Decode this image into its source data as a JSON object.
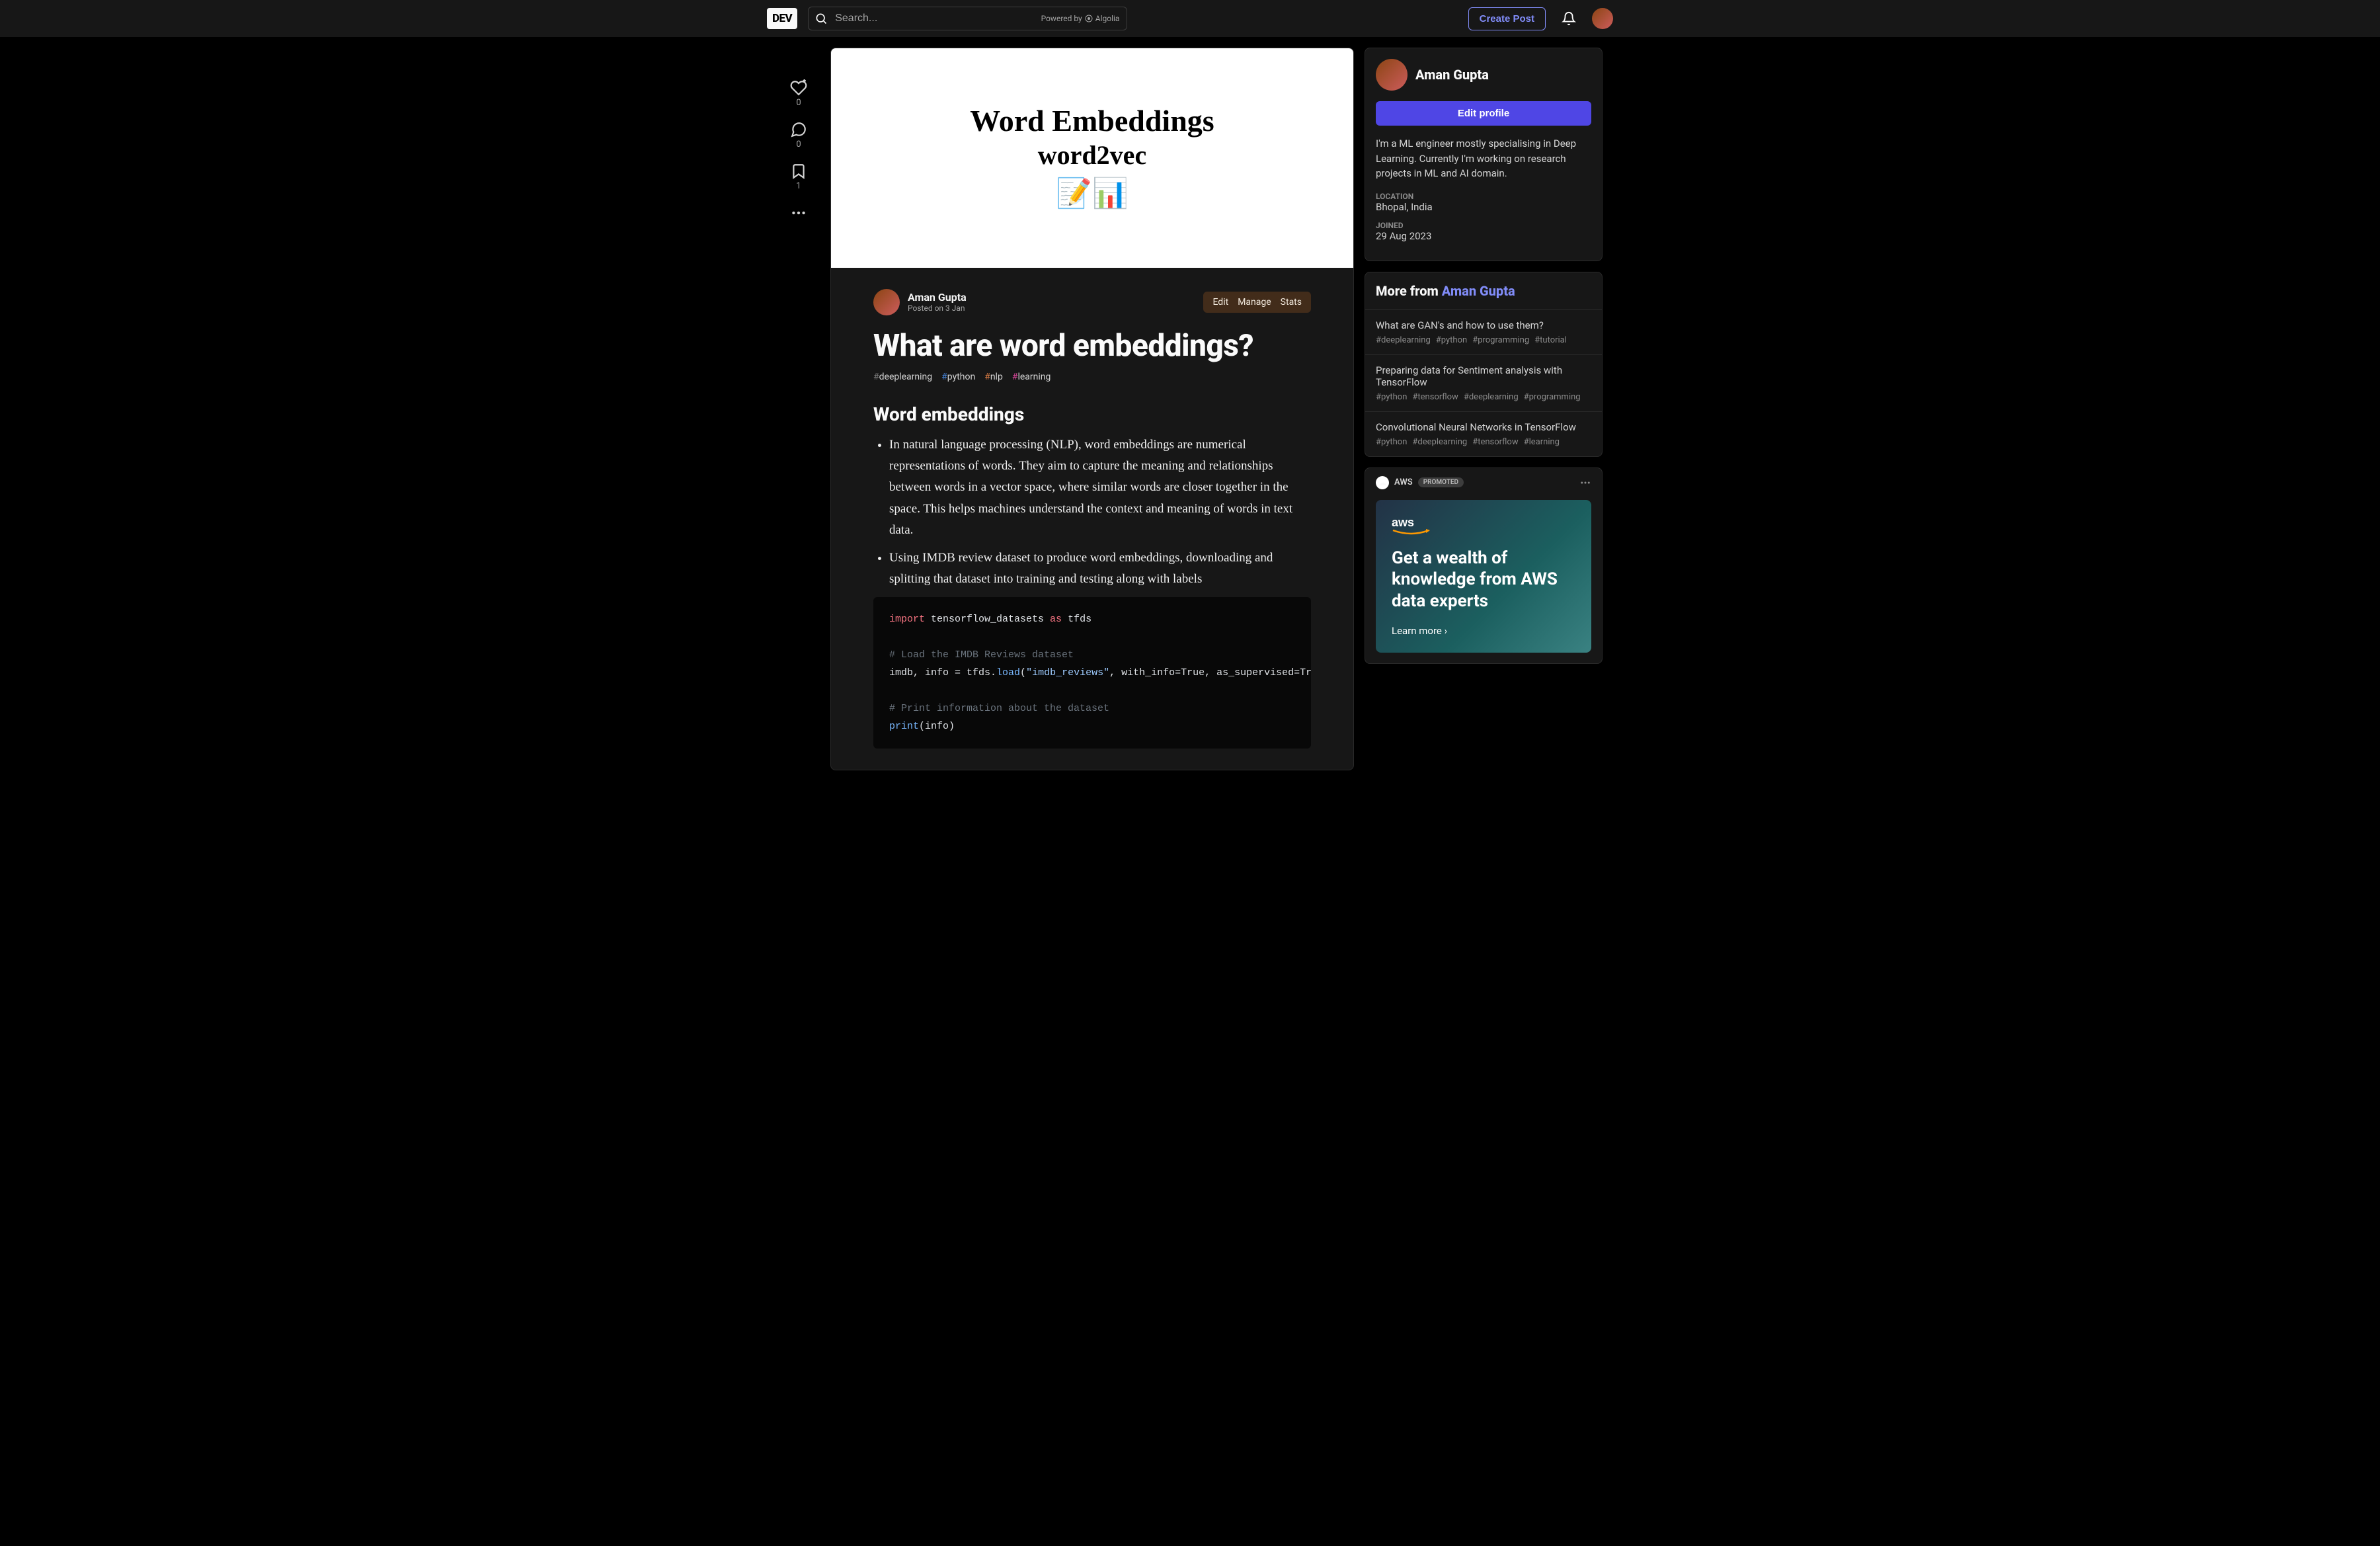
{
  "nav": {
    "logo": "DEV",
    "search_placeholder": "Search...",
    "powered_by": "Powered by",
    "algolia": "Algolia",
    "create_post": "Create Post"
  },
  "rail": {
    "react_count": "0",
    "comment_count": "0",
    "bookmark_count": "1"
  },
  "cover": {
    "line1": "Word Embeddings",
    "line2": "word2vec",
    "emoji": "📝📊"
  },
  "article": {
    "author": "Aman Gupta",
    "posted": "Posted on 3 Jan",
    "actions": {
      "edit": "Edit",
      "manage": "Manage",
      "stats": "Stats"
    },
    "title": "What are word embeddings?",
    "tags": {
      "t1": "deeplearning",
      "t2": "python",
      "t3": "nlp",
      "t4": "learning"
    },
    "section_heading": "Word embeddings",
    "bullets": {
      "b1": "In natural language processing (NLP), word embeddings are numerical representations of words. They aim to capture the meaning and relationships between words in a vector space, where similar words are closer together in the space. This helps machines understand the context and meaning of words in text data.",
      "b2": "Using IMDB review dataset to produce word embeddings, downloading and splitting that dataset into training and testing along with labels"
    },
    "code": {
      "l1a": "import",
      "l1b": " tensorflow_datasets ",
      "l1c": "as",
      "l1d": " tfds",
      "l3": "# Load the IMDB Reviews dataset",
      "l4a": "imdb, info = tfds.",
      "l4b": "load",
      "l4c": "(",
      "l4d": "\"imdb_reviews\"",
      "l4e": ", with_info=True, as_supervised=True",
      "l6": "# Print information about the dataset",
      "l7a": "print",
      "l7b": "(info)"
    }
  },
  "profile": {
    "name": "Aman Gupta",
    "edit_button": "Edit profile",
    "bio": "I'm a ML engineer mostly specialising in Deep Learning. Currently I'm working on research projects in ML and AI domain.",
    "location_label": "LOCATION",
    "location": "Bhopal, India",
    "joined_label": "JOINED",
    "joined": "29 Aug 2023"
  },
  "more_from": {
    "prefix": "More from ",
    "name": "Aman Gupta",
    "items": [
      {
        "title": "What are GAN's and how to use them?",
        "tags": [
          "#deeplearning",
          "#python",
          "#programming",
          "#tutorial"
        ]
      },
      {
        "title": "Preparing data for Sentiment analysis with TensorFlow",
        "tags": [
          "#python",
          "#tensorflow",
          "#deeplearning",
          "#programming"
        ]
      },
      {
        "title": "Convolutional Neural Networks in TensorFlow",
        "tags": [
          "#python",
          "#deeplearning",
          "#tensorflow",
          "#learning"
        ]
      }
    ]
  },
  "promo": {
    "brand": "AWS",
    "badge": "PROMOTED",
    "title": "Get a wealth of knowledge from AWS data experts",
    "cta": "Learn more ›"
  }
}
